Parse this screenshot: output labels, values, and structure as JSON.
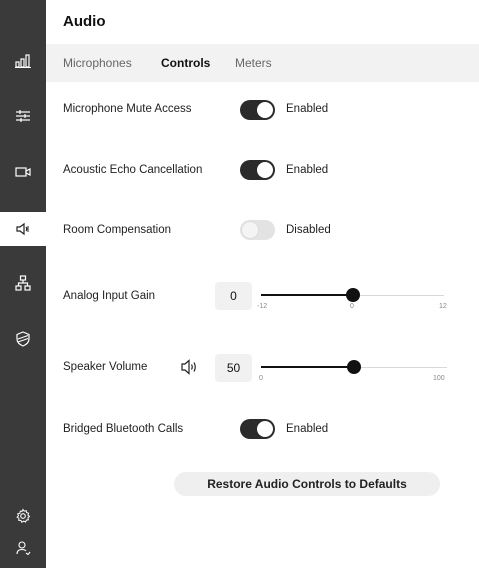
{
  "sidebar": {
    "items": [
      {
        "icon": "bar-chart-icon"
      },
      {
        "icon": "sliders-icon"
      },
      {
        "icon": "camera-icon"
      },
      {
        "icon": "speaker-icon",
        "active": true
      },
      {
        "icon": "network-icon"
      },
      {
        "icon": "shield-icon"
      },
      {
        "icon": "gear-icon"
      },
      {
        "icon": "user-icon"
      }
    ]
  },
  "header": {
    "title": "Audio"
  },
  "tabs": [
    {
      "label": "Microphones",
      "active": false
    },
    {
      "label": "Controls",
      "active": true
    },
    {
      "label": "Meters",
      "active": false
    }
  ],
  "controls": {
    "mic_mute": {
      "label": "Microphone Mute Access",
      "status": "Enabled",
      "on": true
    },
    "echo_cancel": {
      "label": "Acoustic Echo Cancellation",
      "status": "Enabled",
      "on": true
    },
    "room_comp": {
      "label": "Room Compensation",
      "status": "Disabled",
      "on": false
    },
    "analog_gain": {
      "label": "Analog Input Gain",
      "value": "0",
      "min": "-12",
      "mid": "0",
      "max": "12",
      "fraction": 0.5
    },
    "speaker_volume": {
      "label": "Speaker Volume",
      "value": "50",
      "min": "0",
      "max": "100",
      "fraction": 0.5,
      "icon": "speaker-volume-icon"
    },
    "bluetooth": {
      "label": "Bridged Bluetooth Calls",
      "status": "Enabled",
      "on": true
    }
  },
  "restore_button": {
    "label": "Restore Audio Controls to Defaults"
  },
  "colors": {
    "sidebar_bg": "#3a3a3a",
    "accent": "#111111",
    "tab_bar_bg": "#f2f2f2"
  }
}
